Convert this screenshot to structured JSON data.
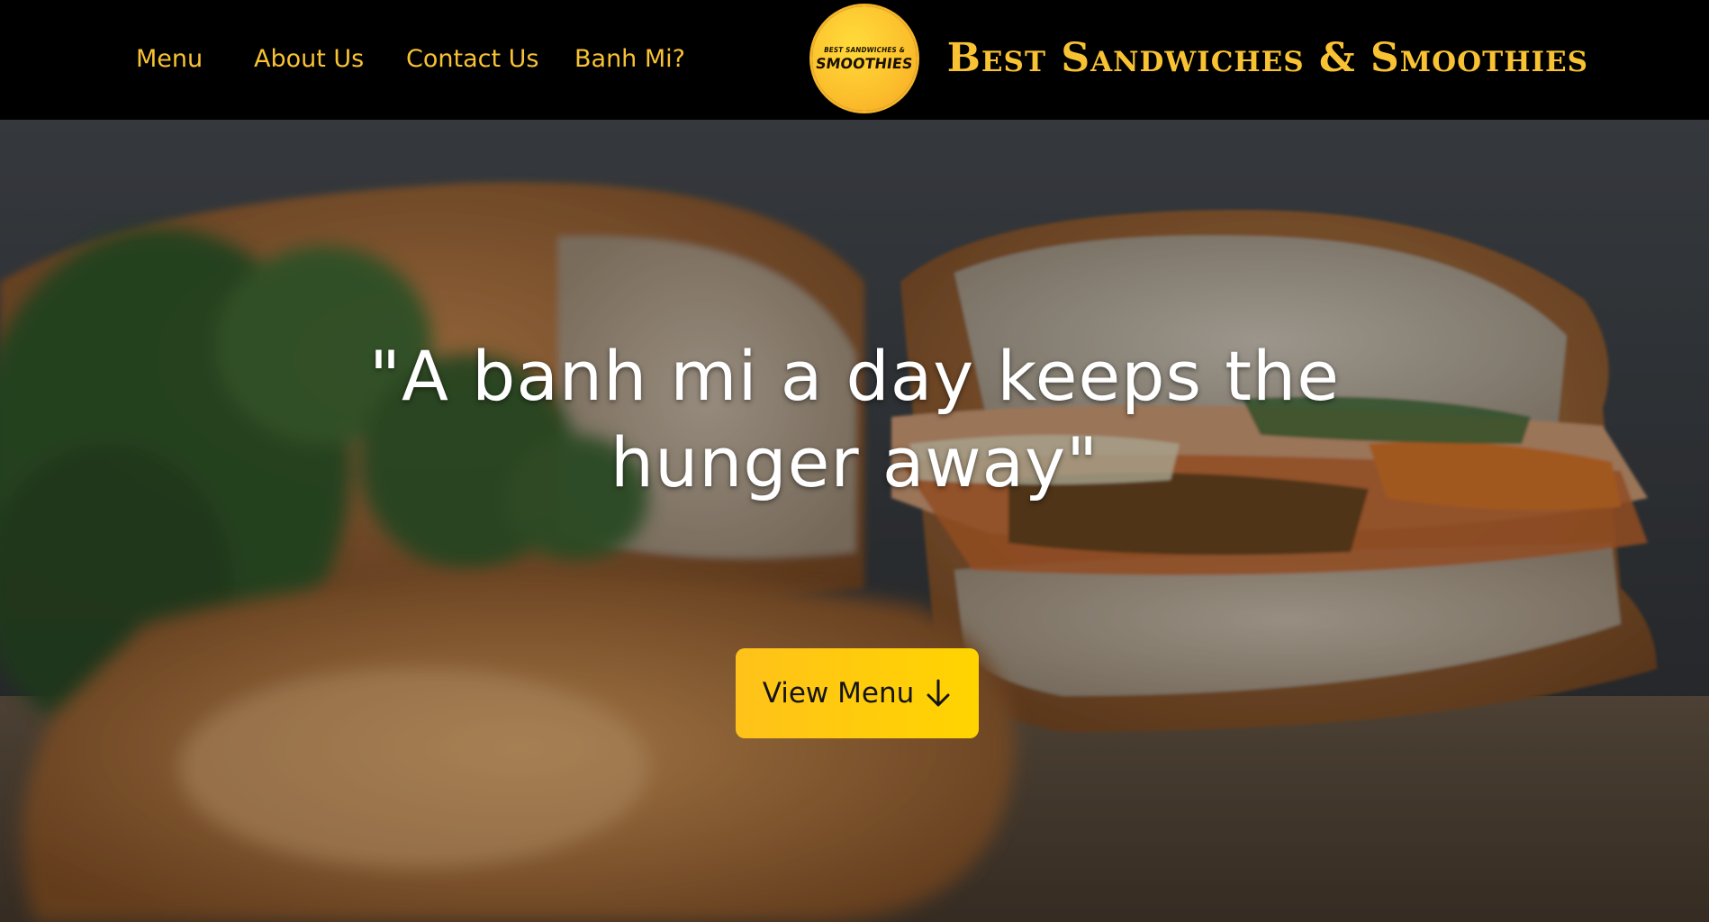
{
  "nav": {
    "links": [
      {
        "label": "Menu"
      },
      {
        "label": "About Us"
      },
      {
        "label": "Contact Us"
      },
      {
        "label": "Banh Mi?"
      }
    ]
  },
  "logo": {
    "top_text": "BEST SANDWICHES &",
    "bottom_text": "SMOOTHIES"
  },
  "brand": {
    "title": "Best Sandwiches & Smoothies"
  },
  "hero": {
    "quote_line1": "\"A banh mi a day keeps the",
    "quote_line2": "hunger away\"",
    "background_image": "banh-mi-sandwich-photo"
  },
  "cta": {
    "label": "View Menu",
    "icon": "arrow-down-icon"
  },
  "colors": {
    "nav_background": "#000000",
    "accent_gold": "#f8c233",
    "button_yellow": "#ffc21a",
    "quote_text": "#ffffff"
  }
}
